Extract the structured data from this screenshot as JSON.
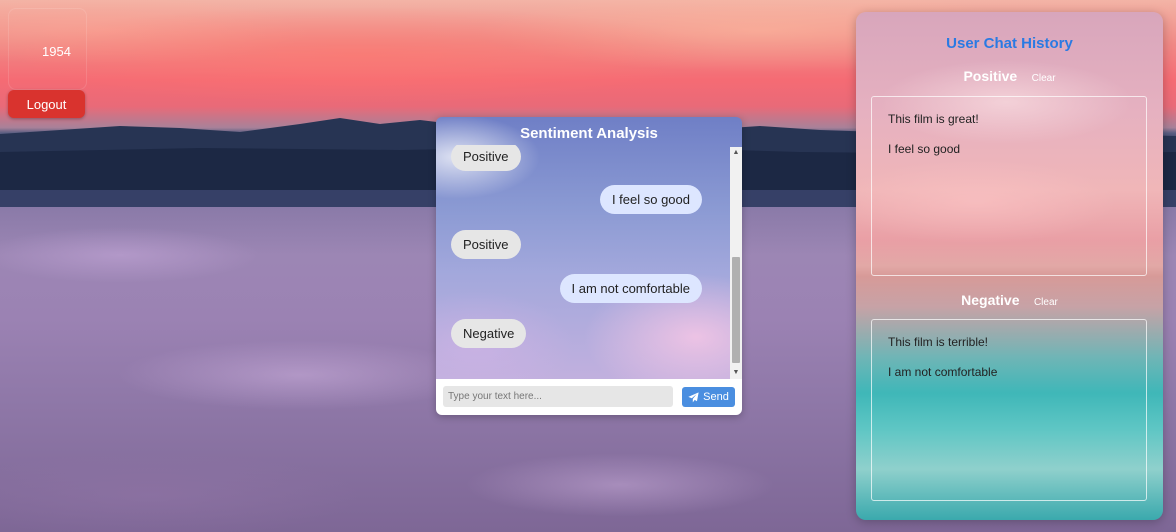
{
  "user": {
    "id": "1954",
    "logout_label": "Logout"
  },
  "chat": {
    "title": "Sentiment Analysis",
    "messages": [
      {
        "sender": "bot",
        "text": "Positive"
      },
      {
        "sender": "user",
        "text": "I feel so good"
      },
      {
        "sender": "bot",
        "text": "Positive"
      },
      {
        "sender": "user",
        "text": "I am not comfortable"
      },
      {
        "sender": "bot",
        "text": "Negative"
      }
    ],
    "input_placeholder": "Type your text here...",
    "input_value": "",
    "send_label": "Send"
  },
  "history": {
    "title": "User Chat History",
    "positive": {
      "label": "Positive",
      "clear_label": "Clear",
      "items": [
        "This film is great!",
        "I feel so good"
      ]
    },
    "negative": {
      "label": "Negative",
      "clear_label": "Clear",
      "items": [
        "This film is terrible!",
        "I am not comfortable"
      ]
    }
  },
  "icons": {
    "send": "paper-plane-icon"
  },
  "colors": {
    "logout": "#d9332e",
    "send": "#4a8ee0",
    "history_title": "#2a7ae3"
  }
}
